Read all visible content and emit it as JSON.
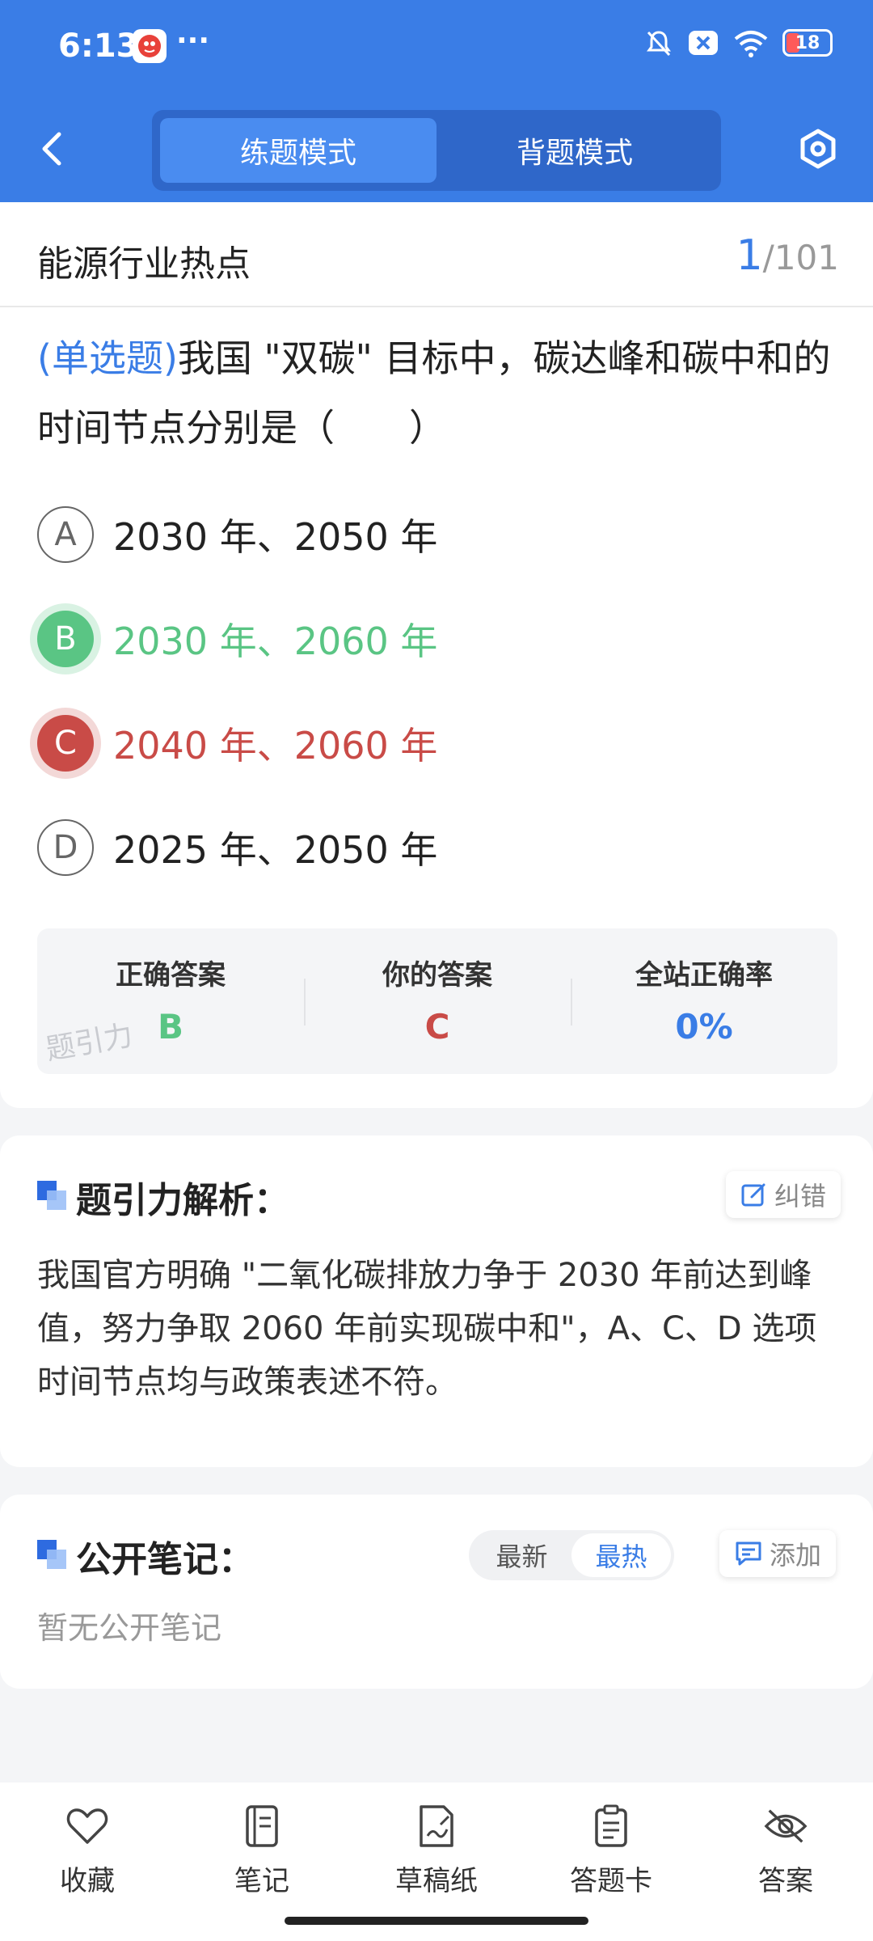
{
  "status_bar": {
    "time": "6:13",
    "dots": "···",
    "battery": "18"
  },
  "header": {
    "tabs": [
      {
        "label": "练题模式",
        "active": true
      },
      {
        "label": "背题模式",
        "active": false
      }
    ],
    "accent": "#3a7de6"
  },
  "section": {
    "title": "能源行业热点",
    "current": "1",
    "total": "/101"
  },
  "question": {
    "type": "(单选题)",
    "text": "我国 \"双碳\" 目标中，碳达峰和碳中和的时间节点分别是（　　）",
    "options": [
      {
        "letter": "A",
        "text": "2030 年、2050 年",
        "state": "normal"
      },
      {
        "letter": "B",
        "text": "2030 年、2060 年",
        "state": "correct"
      },
      {
        "letter": "C",
        "text": "2040 年、2060 年",
        "state": "wrong"
      },
      {
        "letter": "D",
        "text": "2025 年、2050 年",
        "state": "normal"
      }
    ]
  },
  "stats": {
    "correct_label": "正确答案",
    "correct_value": "B",
    "yours_label": "你的答案",
    "yours_value": "C",
    "rate_label": "全站正确率",
    "rate_value": "0%",
    "watermark": "题引力"
  },
  "analysis": {
    "title": "题引力解析：",
    "report_label": "纠错",
    "body": "我国官方明确 \"二氧化碳排放力争于 2030 年前达到峰值，努力争取 2060 年前实现碳中和\"，A、C、D 选项时间节点均与政策表述不符。"
  },
  "notes": {
    "title": "公开笔记：",
    "sort": [
      {
        "label": "最新",
        "active": false
      },
      {
        "label": "最热",
        "active": true
      }
    ],
    "add_label": "添加",
    "empty": "暂无公开笔记"
  },
  "bottom_nav": [
    {
      "label": "收藏",
      "icon": "heart-icon"
    },
    {
      "label": "笔记",
      "icon": "notebook-icon"
    },
    {
      "label": "草稿纸",
      "icon": "draft-paper-icon"
    },
    {
      "label": "答题卡",
      "icon": "answer-sheet-icon"
    },
    {
      "label": "答案",
      "icon": "eye-off-icon"
    }
  ]
}
